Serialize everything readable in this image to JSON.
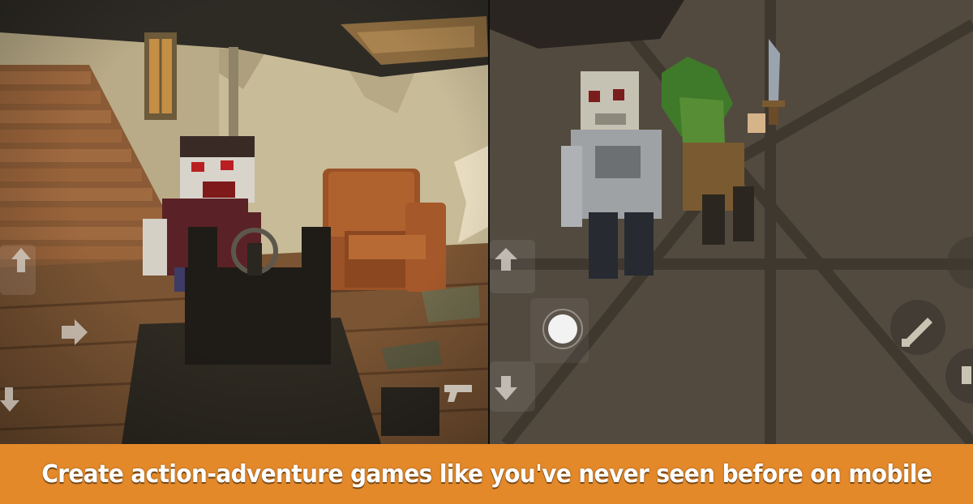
{
  "banner": {
    "caption": "Create action-adventure games like you've never seen before on mobile",
    "background": "#e3892a",
    "text_color": "#ffffff"
  },
  "left_panel": {
    "scene": "first-person",
    "controls": [
      "arrow-up-icon",
      "arrow-right-icon",
      "arrow-down-icon",
      "pistol-icon"
    ]
  },
  "right_panel": {
    "scene": "top-down",
    "controls": [
      "arrow-up-icon",
      "arrow-down-icon",
      "joystick-knob",
      "sword-icon",
      "ammo-icon"
    ]
  }
}
